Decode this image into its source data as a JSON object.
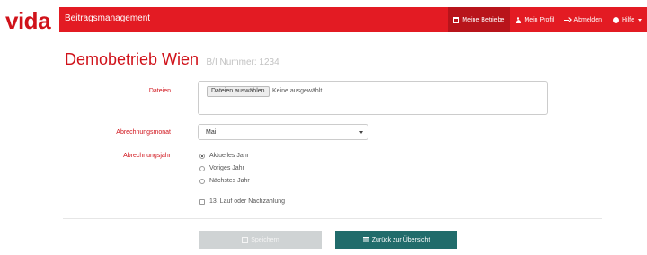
{
  "brand": {
    "logo_text": "vida",
    "app_title": "Beitragsmanagement"
  },
  "nav": {
    "items": [
      {
        "label": "Meine Betriebe",
        "icon": "building-icon",
        "active": true
      },
      {
        "label": "Mein Profil",
        "icon": "user-icon",
        "active": false
      },
      {
        "label": "Abmelden",
        "icon": "logout-icon",
        "active": false
      },
      {
        "label": "Hilfe",
        "icon": "help-icon",
        "active": false
      }
    ]
  },
  "page": {
    "company": "Demobetrieb Wien",
    "bi_label": "B/I Nummer: 1234"
  },
  "form": {
    "files": {
      "label": "Dateien",
      "button": "Dateien auswählen",
      "status": "Keine ausgewählt"
    },
    "month": {
      "label": "Abrechnungsmonat",
      "value": "Mai"
    },
    "year": {
      "label": "Abrechnungsjahr",
      "options": [
        {
          "label": "Aktuelles Jahr",
          "checked": true
        },
        {
          "label": "Voriges Jahr",
          "checked": false
        },
        {
          "label": "Nächstes Jahr",
          "checked": false
        }
      ]
    },
    "extra_checkbox": {
      "label": "13. Lauf oder Nachzahlung",
      "checked": false
    }
  },
  "actions": {
    "save": "Speichern",
    "back": "Zurück zur Übersicht"
  },
  "colors": {
    "brand_red": "#e31b23",
    "logo_red": "#d0121a",
    "active_nav": "#b8141b",
    "back_button": "#216c6b",
    "disabled_button": "#cfd3d4"
  }
}
